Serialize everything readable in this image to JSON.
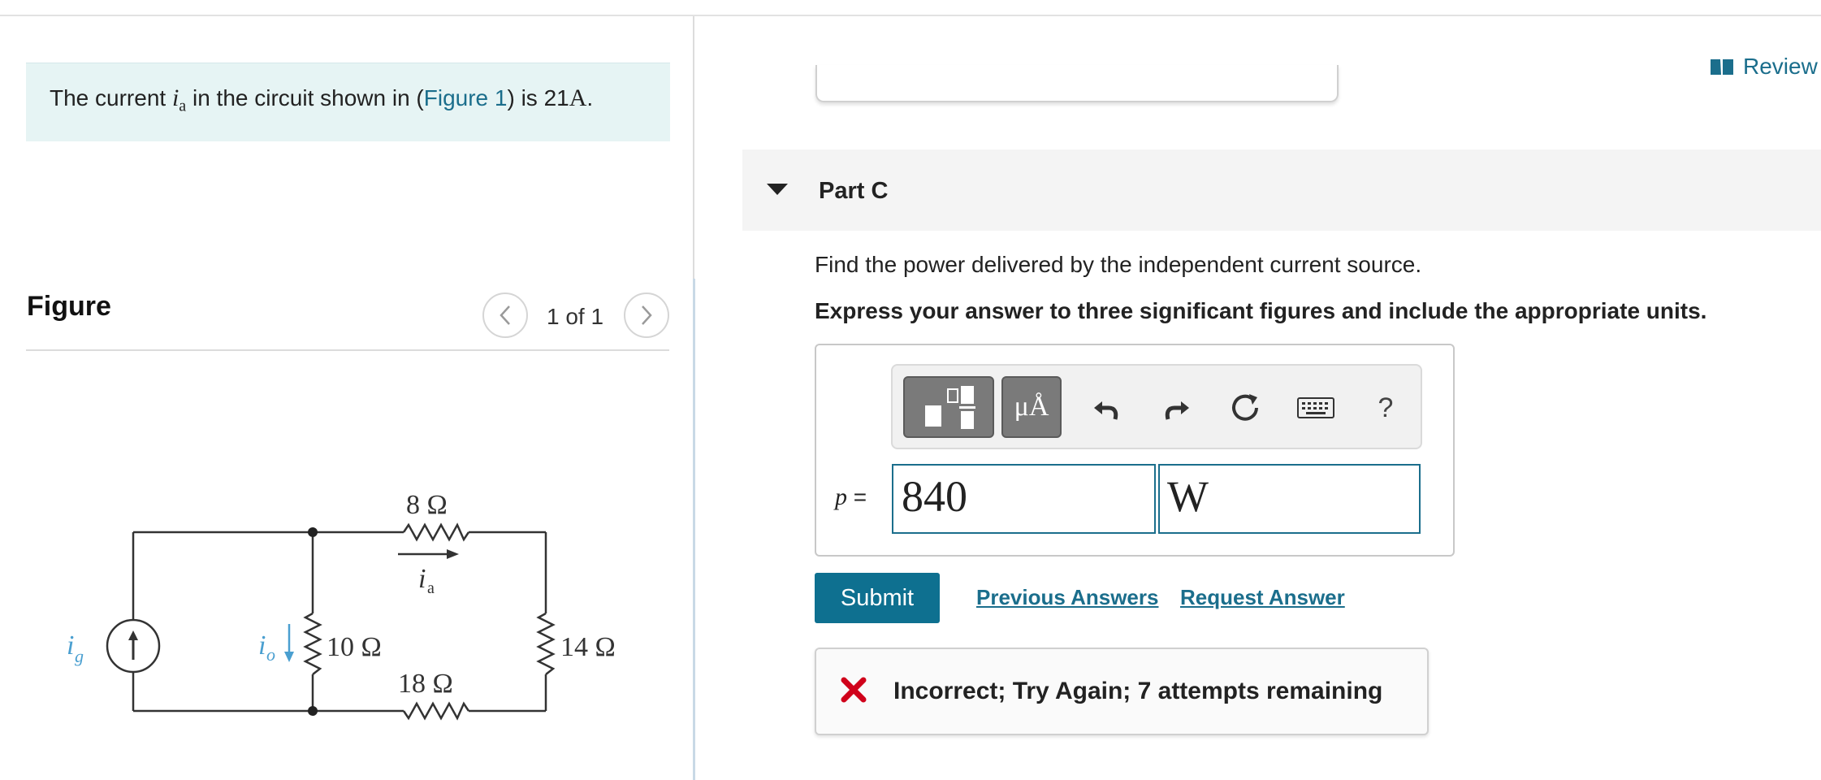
{
  "problem": {
    "text_before": "The current ",
    "variable": "i",
    "variable_sub": "a",
    "text_middle": " in the circuit shown in (",
    "figure_link": "Figure 1",
    "text_after": ") is 21",
    "unit": "A",
    "end": "."
  },
  "figure": {
    "title": "Figure",
    "pager": "1 of 1",
    "circuit": {
      "r_top": "8 Ω",
      "r_left": "10 Ω",
      "r_right": "14 Ω",
      "r_bottom": "18 Ω",
      "source_label": "i",
      "source_sub": "g",
      "io_label": "i",
      "io_sub": "o",
      "ia_label": "i",
      "ia_sub": "a"
    }
  },
  "header": {
    "review_label": "Review"
  },
  "part": {
    "title": "Part C",
    "question": "Find the power delivered by the independent current source.",
    "instruction": "Express your answer to three significant figures and include the appropriate units."
  },
  "answer": {
    "variable": "p",
    "equals": " =",
    "value": "840",
    "unit": "W",
    "toolbar": {
      "units_label": "μÅ",
      "help_label": "?"
    }
  },
  "actions": {
    "submit_label": "Submit",
    "previous_answers_label": "Previous Answers",
    "request_answer_label": "Request Answer"
  },
  "feedback": {
    "text": "Incorrect; Try Again; 7 attempts remaining",
    "icon": "x-icon",
    "color": "#d0021b"
  },
  "colors": {
    "accent": "#0e7090",
    "link": "#1b6e8c",
    "circuit_label": "#4a9fd0"
  }
}
